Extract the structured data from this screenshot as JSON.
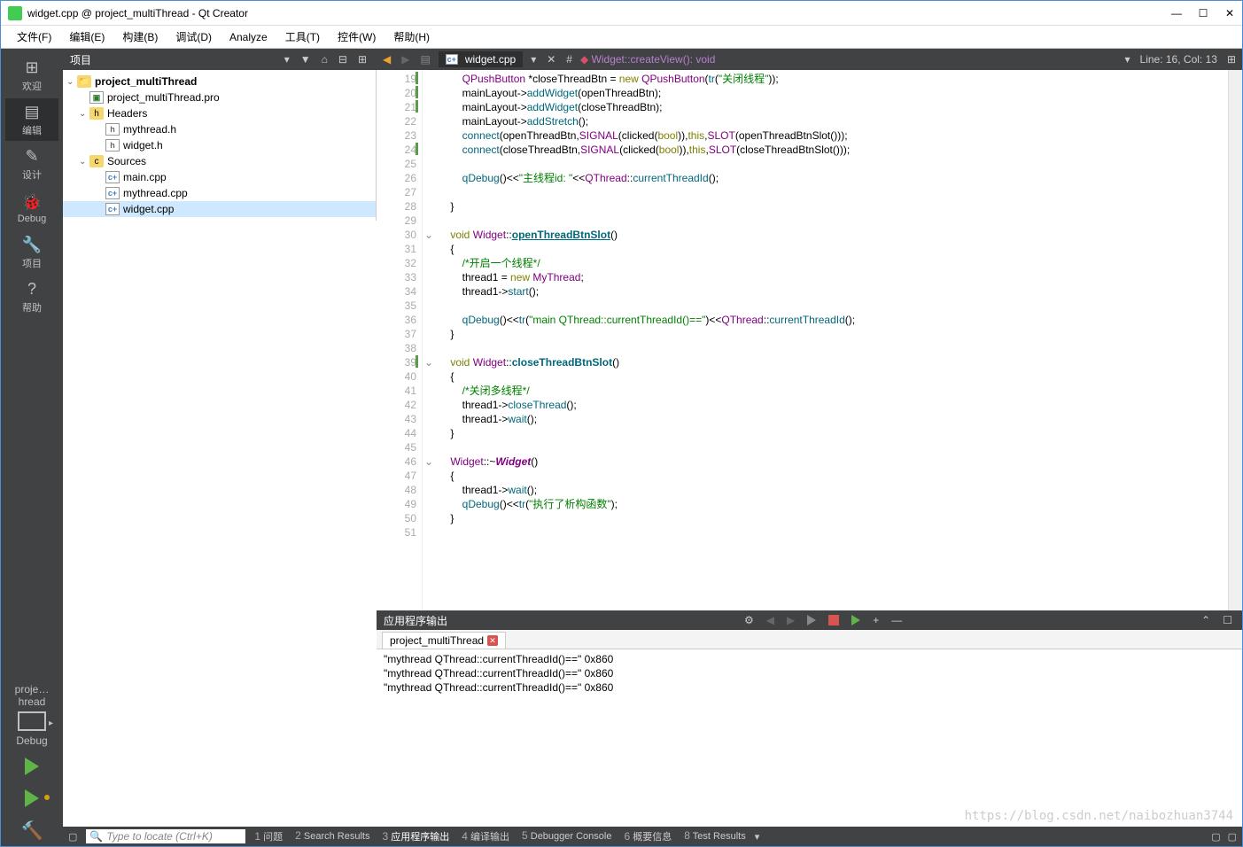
{
  "title": "widget.cpp @ project_multiThread - Qt Creator",
  "menus": [
    "文件(F)",
    "编辑(E)",
    "构建(B)",
    "调试(D)",
    "Analyze",
    "工具(T)",
    "控件(W)",
    "帮助(H)"
  ],
  "modes": [
    {
      "icon": "⊞",
      "label": "欢迎"
    },
    {
      "icon": "▤",
      "label": "编辑",
      "active": true
    },
    {
      "icon": "✎",
      "label": "设计"
    },
    {
      "icon": "🐞",
      "label": "Debug"
    },
    {
      "icon": "🔧",
      "label": "项目"
    },
    {
      "icon": "?",
      "label": "帮助"
    }
  ],
  "kit": {
    "name": "proje…hread",
    "config": "Debug"
  },
  "project_panel_title": "项目",
  "tree": {
    "root": "project_multiThread",
    "pro": "project_multiThread.pro",
    "headers_label": "Headers",
    "headers": [
      "mythread.h",
      "widget.h"
    ],
    "sources_label": "Sources",
    "sources": [
      "main.cpp",
      "mythread.cpp",
      "widget.cpp"
    ]
  },
  "editor": {
    "file": "widget.cpp",
    "crumb": "Widget::createView(): void",
    "pos": "Line: 16, Col: 13",
    "lines": [
      {
        "n": 19,
        "mark": true,
        "html": "        <span class='type'>QPushButton</span> *closeThreadBtn = <span class='kw'>new</span> <span class='type'>QPushButton</span>(<span class='fn'>tr</span>(<span class='str'>\"关闭线程\"</span>));"
      },
      {
        "n": 20,
        "mark": true,
        "html": "        mainLayout-&gt;<span class='fn'>addWidget</span>(openThreadBtn);"
      },
      {
        "n": 21,
        "mark": true,
        "html": "        mainLayout-&gt;<span class='fn'>addWidget</span>(closeThreadBtn);"
      },
      {
        "n": 22,
        "html": "        mainLayout-&gt;<span class='fn'>addStretch</span>();"
      },
      {
        "n": 23,
        "html": "        <span class='fn'>connect</span>(openThreadBtn,<span class='type'>SIGNAL</span>(clicked(<span class='bool'>bool</span>)),<span class='kw'>this</span>,<span class='type'>SLOT</span>(openThreadBtnSlot()));"
      },
      {
        "n": 24,
        "mark": true,
        "html": "        <span class='fn'>connect</span>(closeThreadBtn,<span class='type'>SIGNAL</span>(clicked(<span class='bool'>bool</span>)),<span class='kw'>this</span>,<span class='type'>SLOT</span>(closeThreadBtnSlot()));"
      },
      {
        "n": 25,
        "html": ""
      },
      {
        "n": 26,
        "html": "        <span class='fn'>qDebug</span>()&lt;&lt;<span class='str'>\"主线程id: \"</span>&lt;&lt;<span class='type'>QThread</span>::<span class='fn'>currentThreadId</span>();"
      },
      {
        "n": 27,
        "html": ""
      },
      {
        "n": 28,
        "html": "    }"
      },
      {
        "n": 29,
        "html": ""
      },
      {
        "n": 30,
        "fold": true,
        "html": "    <span class='kw'>void</span> <span class='type'>Widget</span>::<span class='link'>openThreadBtnSlot</span>()"
      },
      {
        "n": 31,
        "html": "    {"
      },
      {
        "n": 32,
        "html": "        <span class='cmt'>/*开启一个线程*/</span>"
      },
      {
        "n": 33,
        "html": "        thread1 = <span class='kw'>new</span> <span class='type'>MyThread</span>;"
      },
      {
        "n": 34,
        "html": "        thread1-&gt;<span class='fn'>start</span>();"
      },
      {
        "n": 35,
        "html": ""
      },
      {
        "n": 36,
        "html": "        <span class='fn'>qDebug</span>()&lt;&lt;<span class='fn'>tr</span>(<span class='str'>\"main QThread::currentThreadId()==\"</span>)&lt;&lt;<span class='type'>QThread</span>::<span class='fn'>currentThreadId</span>();"
      },
      {
        "n": 37,
        "html": "    }"
      },
      {
        "n": 38,
        "html": ""
      },
      {
        "n": 39,
        "mark": true,
        "fold": true,
        "html": "    <span class='kw'>void</span> <span class='type'>Widget</span>::<span class='fn' style='font-weight:bold'>closeThreadBtnSlot</span>()"
      },
      {
        "n": 40,
        "html": "    {"
      },
      {
        "n": 41,
        "html": "        <span class='cmt'>/*关闭多线程*/</span>"
      },
      {
        "n": 42,
        "html": "        thread1-&gt;<span class='fn'>closeThread</span>();"
      },
      {
        "n": 43,
        "html": "        thread1-&gt;<span class='fn'>wait</span>();"
      },
      {
        "n": 44,
        "html": "    }"
      },
      {
        "n": 45,
        "html": ""
      },
      {
        "n": 46,
        "fold": true,
        "html": "    <span class='type'>Widget</span>::~<span class='type it'>Widget</span>()"
      },
      {
        "n": 47,
        "html": "    {"
      },
      {
        "n": 48,
        "html": "        thread1-&gt;<span class='fn'>wait</span>();"
      },
      {
        "n": 49,
        "html": "        <span class='fn'>qDebug</span>()&lt;&lt;<span class='fn'>tr</span>(<span class='str'>\"执行了析构函数\"</span>);"
      },
      {
        "n": 50,
        "html": "    }"
      },
      {
        "n": 51,
        "html": ""
      }
    ]
  },
  "output": {
    "title": "应用程序输出",
    "tab": "project_multiThread",
    "lines": [
      "\"mythread QThread::currentThreadId()==\"  0x860",
      "\"mythread QThread::currentThreadId()==\"  0x860",
      "\"mythread QThread::currentThreadId()==\"  0x860"
    ],
    "watermark": "https://blog.csdn.net/naibozhuan3744"
  },
  "locator_placeholder": "Type to locate (Ctrl+K)",
  "status_tabs": [
    {
      "n": "1",
      "label": "问题"
    },
    {
      "n": "2",
      "label": "Search Results"
    },
    {
      "n": "3",
      "label": "应用程序输出",
      "active": true
    },
    {
      "n": "4",
      "label": "编译输出"
    },
    {
      "n": "5",
      "label": "Debugger Console"
    },
    {
      "n": "6",
      "label": "概要信息"
    },
    {
      "n": "8",
      "label": "Test Results"
    }
  ]
}
